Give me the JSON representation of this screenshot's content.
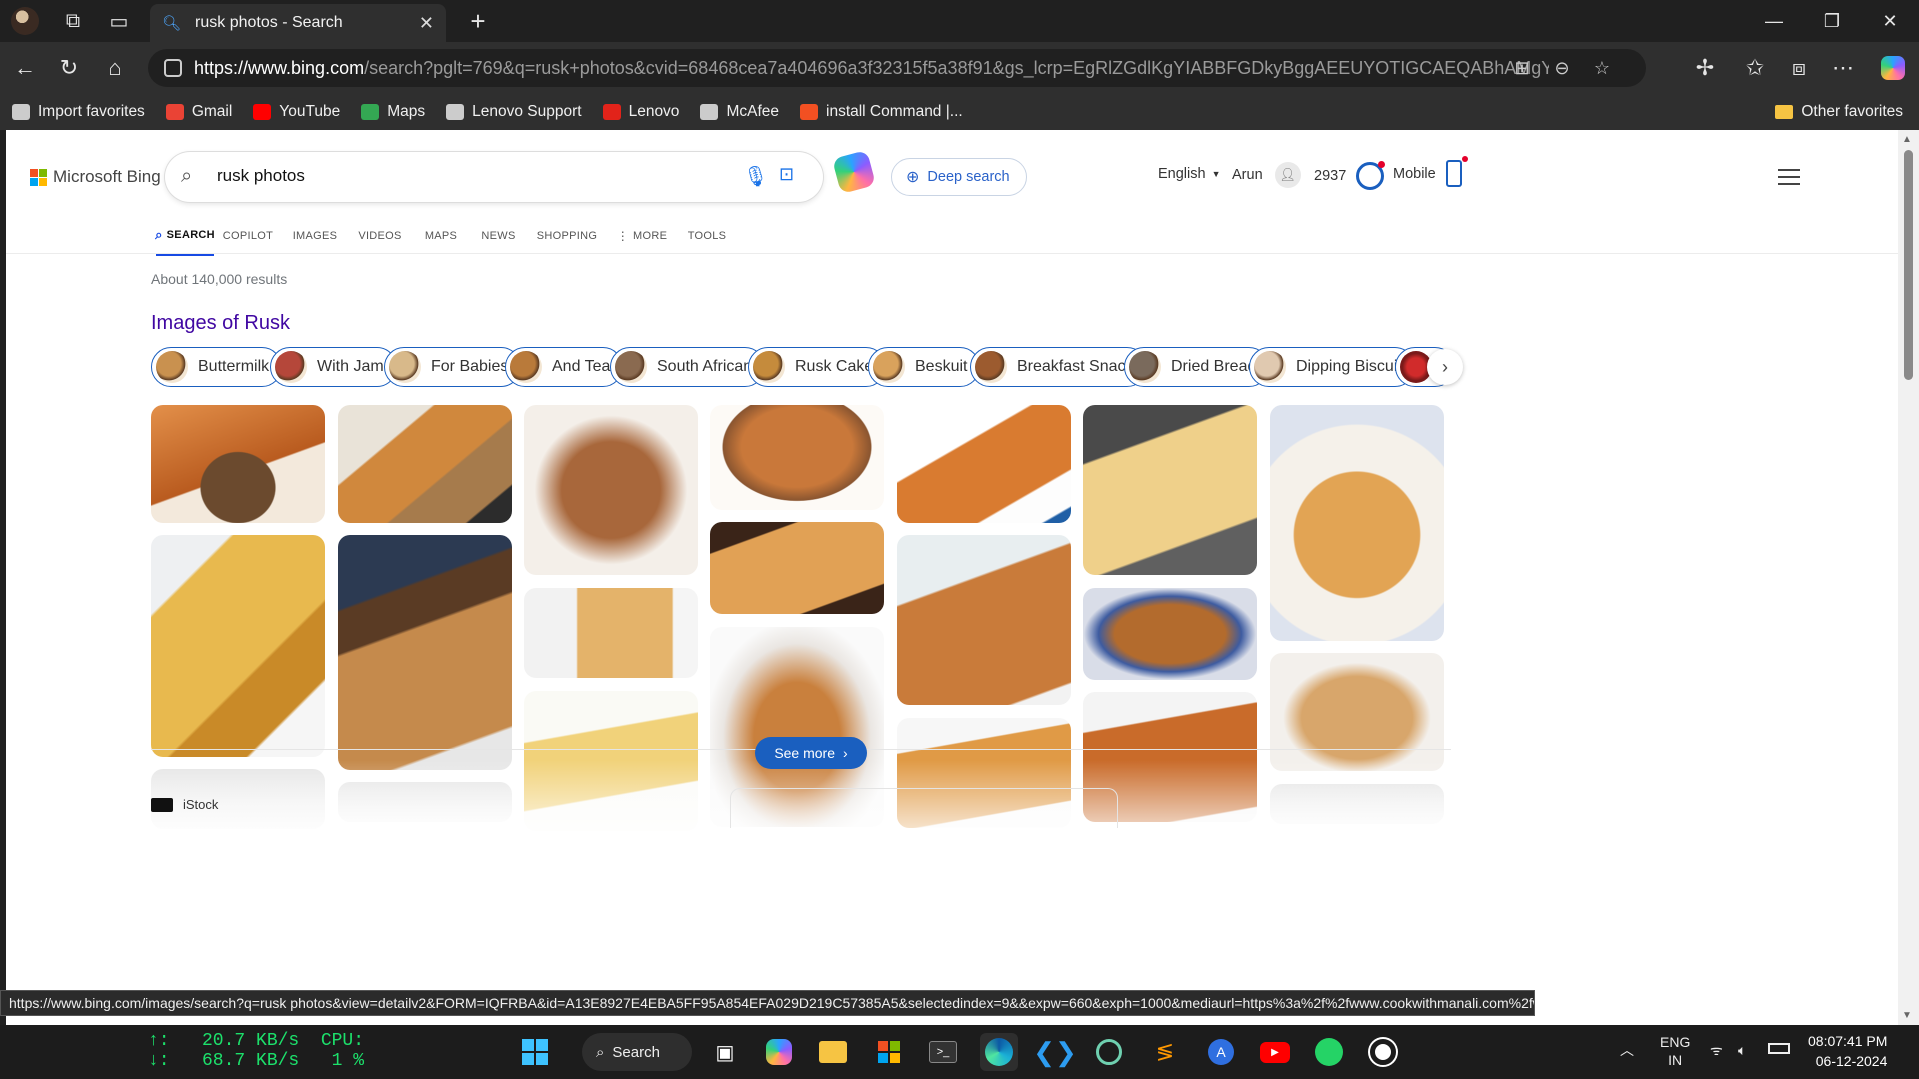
{
  "browser": {
    "tab_title": "rusk photos - Search",
    "url_host": "https://www.bing.com",
    "url_rest": "/search?pglt=769&q=rusk+photos&cvid=68468cea7a404696a3f32315f5a38f91&gs_lcrp=EgRlZGdlKgYIABBFGDkyBggAEEUYOTIGCAEQABhAMgYIAhAA...",
    "bookmarks": [
      {
        "label": "Import favorites",
        "icon": "import-icon",
        "color": "#cccccc"
      },
      {
        "label": "Gmail",
        "icon": "gmail-icon",
        "color": "#ea4335"
      },
      {
        "label": "YouTube",
        "icon": "youtube-icon",
        "color": "#ff0000"
      },
      {
        "label": "Maps",
        "icon": "maps-pin-icon",
        "color": "#34a853"
      },
      {
        "label": "Lenovo Support",
        "icon": "document-icon",
        "color": "#cccccc"
      },
      {
        "label": "Lenovo",
        "icon": "lenovo-icon",
        "color": "#e2231a"
      },
      {
        "label": "McAfee",
        "icon": "document-icon",
        "color": "#cccccc"
      },
      {
        "label": "install Command |...",
        "icon": "windows-logo-icon",
        "color": "#f25022"
      }
    ],
    "other_favorites": "Other favorites",
    "status_url": "https://www.bing.com/images/search?q=rusk photos&view=detailv2&FORM=IQFRBA&id=A13E8927E4EBA5FF95A854EFA029D219C57385A5&selectedindex=9&&expw=660&exph=1000&mediaurl=https%3a%2f%2fwww.cookwithmanali.com%2fwp-content%2fuploads%2f2017%..."
  },
  "bing": {
    "logo_text": "Microsoft Bing",
    "query": "rusk photos",
    "deep_search": "Deep search",
    "language": "English",
    "user": "Arun",
    "points": "2937",
    "mobile": "Mobile",
    "tabs": [
      "SEARCH",
      "COPILOT",
      "IMAGES",
      "VIDEOS",
      "MAPS",
      "NEWS",
      "SHOPPING",
      "MORE",
      "TOOLS"
    ],
    "results_count": "About 140,000 results",
    "images_heading": "Images of Rusk",
    "chips": [
      "Buttermilk",
      "With Jam",
      "For Babies",
      "And Tea",
      "South African",
      "Rusk Cake",
      "Beskuit",
      "Breakfast Snack",
      "Dried Bread",
      "Dipping Biscuit"
    ],
    "see_more": "See more",
    "source": "iStock"
  },
  "taskbar": {
    "net_up": "↑:   20.7 KB/s  CPU:",
    "net_down": "↓:   68.7 KB/s   1 %",
    "search": "Search",
    "lang_top": "ENG",
    "lang_bottom": "IN",
    "time": "08:07:41 PM",
    "date": "06-12-2024"
  }
}
